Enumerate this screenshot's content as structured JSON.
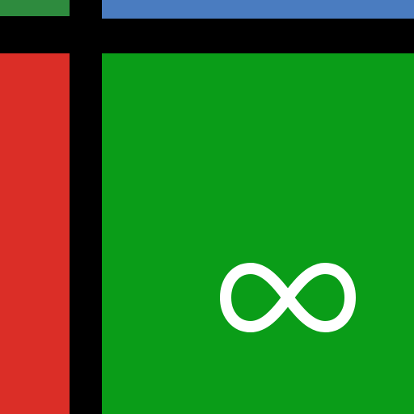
{
  "icon": {
    "symbol_icon": "infinity-icon",
    "colors": {
      "background": "#000000",
      "top_left": "#2E8B3E",
      "top_right": "#4A7CC0",
      "left": "#DB2E27",
      "main": "#0A9D18",
      "symbol": "#FFFFFF"
    }
  }
}
